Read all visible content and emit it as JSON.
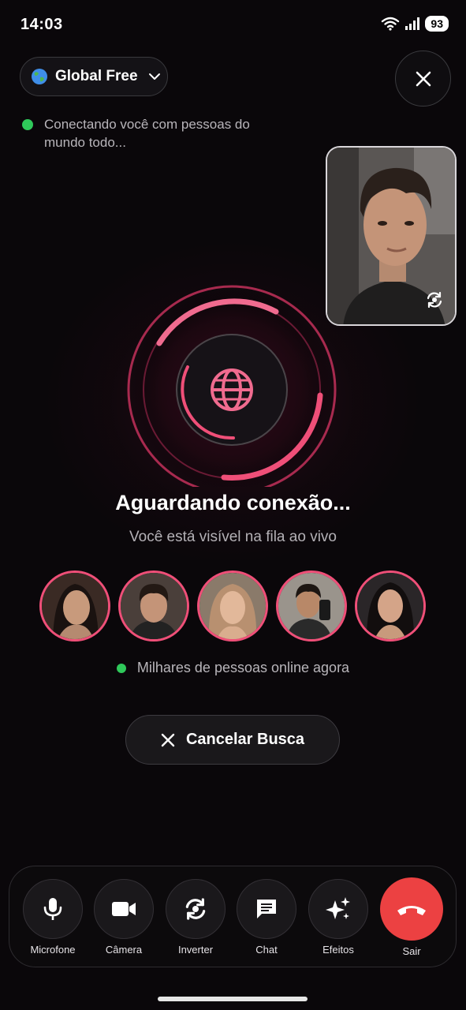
{
  "status_bar": {
    "time": "14:03",
    "battery": "93"
  },
  "region": {
    "label": "Global Free",
    "icon": "globe-icon"
  },
  "connecting_text": "Conectando você com pessoas do mundo todo...",
  "waiting": {
    "title": "Aguardando conexão...",
    "subtitle": "Você está visível na fila ao vivo"
  },
  "online_text": "Milhares de pessoas online agora",
  "cancel_button": {
    "label": "Cancelar Busca"
  },
  "controls": [
    {
      "label": "Microfone",
      "icon": "microphone-icon"
    },
    {
      "label": "Câmera",
      "icon": "video-camera-icon"
    },
    {
      "label": "Inverter",
      "icon": "flip-camera-icon"
    },
    {
      "label": "Chat",
      "icon": "chat-icon"
    },
    {
      "label": "Efeitos",
      "icon": "sparkles-icon"
    },
    {
      "label": "Sair",
      "icon": "hang-up-icon"
    }
  ],
  "colors": {
    "accent": "#ef4f78",
    "online": "#2fc85a",
    "end_call": "#ec4142",
    "background": "#0a070a"
  }
}
